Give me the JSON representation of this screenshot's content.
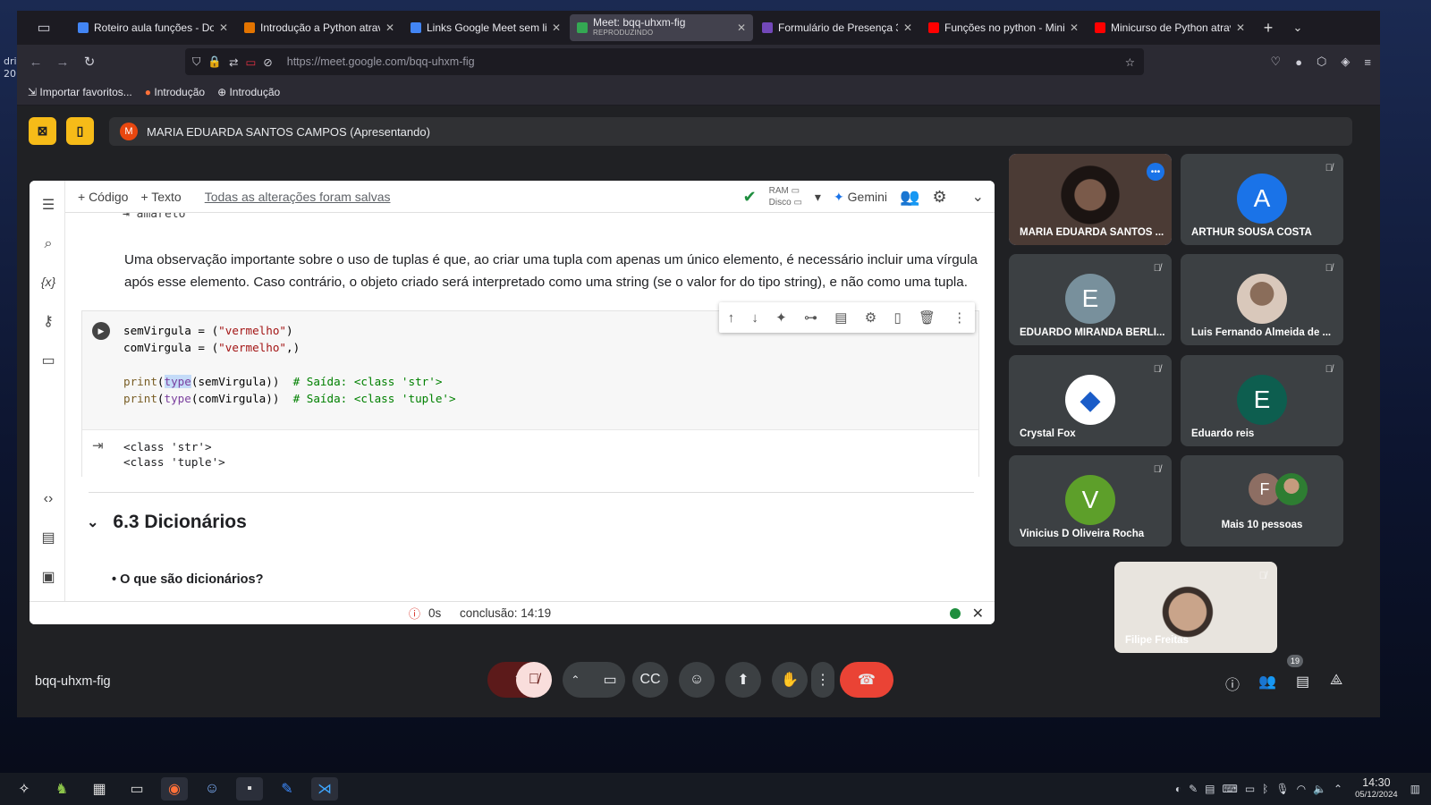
{
  "desktop": {
    "label": "dri\n20"
  },
  "browser": {
    "tabs": [
      {
        "title": "Roteiro aula funções - Doc",
        "color": "#4285f4",
        "active": false
      },
      {
        "title": "Introdução a Python através",
        "color": "#e37400",
        "active": false
      },
      {
        "title": "Links Google Meet sem lim",
        "color": "#4285f4",
        "active": false
      },
      {
        "title": "Meet: bqq-uhxm-fig",
        "subtitle": "REPRODUZINDO",
        "color": "#34a853",
        "active": true
      },
      {
        "title": "Formulário de Presença 3",
        "color": "#7248b9",
        "active": false
      },
      {
        "title": "Funções no python - Minic",
        "color": "#ff0000",
        "active": false
      },
      {
        "title": "Minicurso de Python atrav",
        "color": "#ff0000",
        "active": false
      }
    ],
    "url": "https://meet.google.com/bqq-uhxm-fig",
    "bookmarks": [
      "Importar favoritos...",
      "Introdução",
      "Introdução"
    ]
  },
  "meet": {
    "presenter": "MARIA EDUARDA SANTOS CAMPOS (Apresentando)",
    "presenter_initial": "M",
    "meeting_code": "bqq-uhxm-fig",
    "participants_count": "19",
    "participants": [
      {
        "name": "MARIA EDUARDA SANTOS ...",
        "type": "photo",
        "colors": [
          "#4b3b35",
          "#7a5a4a"
        ]
      },
      {
        "name": "ARTHUR SOUSA COSTA",
        "type": "initial",
        "initial": "A",
        "color": "#1a73e8"
      },
      {
        "name": "EDUARDO MIRANDA BERLI...",
        "type": "initial",
        "initial": "E",
        "color": "#78909c"
      },
      {
        "name": "Luis Fernando Almeida de ...",
        "type": "photo",
        "colors": [
          "#d9c8bb",
          "#8a6d5a"
        ]
      },
      {
        "name": "Crystal Fox",
        "type": "crystal",
        "color": "#1a5cc8"
      },
      {
        "name": "Eduardo reis",
        "type": "initial",
        "initial": "E",
        "color": "#0d5e4f"
      },
      {
        "name": "Vinicius D Oliveira Rocha",
        "type": "initial",
        "initial": "V",
        "color": "#5d9f2a"
      },
      {
        "name": "Mais 10 pessoas",
        "type": "more",
        "initial": "F",
        "color": "#8d6e63"
      }
    ],
    "self_tile": {
      "name": "Filipe Freitas"
    }
  },
  "colab": {
    "toolbar": {
      "code_btn": "+ Código",
      "text_btn": "+ Texto",
      "saved": "Todas as alterações foram salvas",
      "ram": "RAM",
      "disk": "Disco",
      "gemini": "Gemini"
    },
    "prev_output": "amarelo",
    "paragraph": "Uma observação importante sobre o uso de tuplas é que, ao criar uma tupla com apenas um único elemento, é necessário incluir uma vírgula após esse elemento. Caso contrário, o objeto criado será interpretado como uma string (se o valor for do tipo string), e não como uma tupla.",
    "output": "<class 'str'>\n<class 'tuple'>",
    "section": "6.3 Dicionários",
    "bullet": "O que são dicionários?",
    "status": {
      "time": "0s",
      "conclusion": "conclusão: 14:19"
    }
  },
  "taskbar": {
    "time": "14:30",
    "date": "05/12/2024"
  }
}
